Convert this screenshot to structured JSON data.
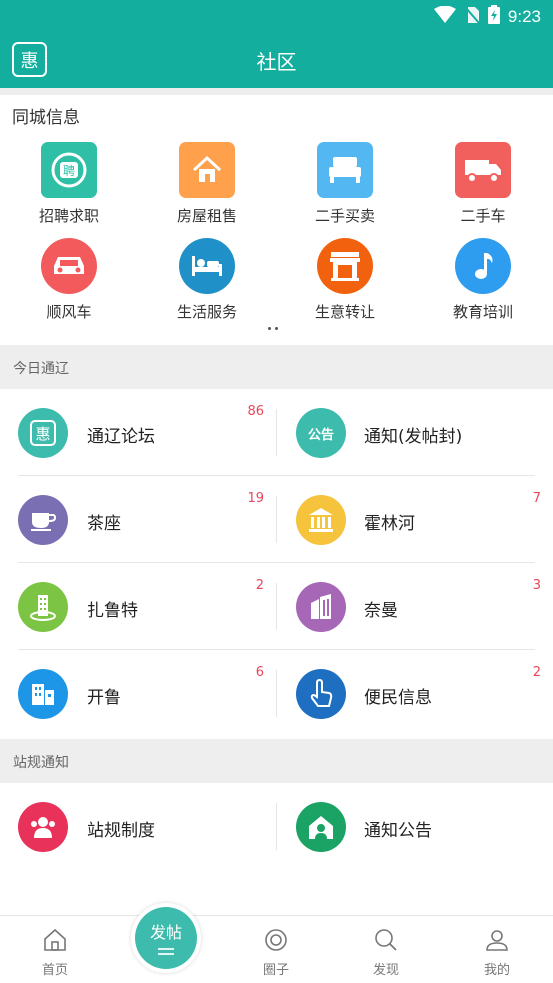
{
  "status_bar": {
    "time": "9:23"
  },
  "app_bar": {
    "title": "社区",
    "logo_glyph": "惠"
  },
  "city_info": {
    "title": "同城信息",
    "items": [
      {
        "label": "招聘求职",
        "icon": "recruit-icon",
        "color": "#2fbfa6"
      },
      {
        "label": "房屋租售",
        "icon": "house-icon",
        "color": "#ffa04d"
      },
      {
        "label": "二手买卖",
        "icon": "bed-icon",
        "color": "#53b7f2"
      },
      {
        "label": "二手车",
        "icon": "truck-icon",
        "color": "#f2605e"
      },
      {
        "label": "顺风车",
        "icon": "car-icon",
        "color": "#f25a5c"
      },
      {
        "label": "生活服务",
        "icon": "bed-service-icon",
        "color": "#2090c8"
      },
      {
        "label": "生意转让",
        "icon": "shop-icon",
        "color": "#f2620e"
      },
      {
        "label": "教育培训",
        "icon": "music-note-icon",
        "color": "#2e9df0"
      }
    ]
  },
  "today_section": {
    "title": "今日通辽",
    "rows": [
      [
        {
          "name": "通辽论坛",
          "count": "86",
          "icon": "hui-icon",
          "color": "#3dbcad"
        },
        {
          "name": "通知(发帖封)",
          "count": "",
          "icon": "notice-icon",
          "color": "#3dbcad",
          "glyph": "公告"
        }
      ],
      [
        {
          "name": "茶座",
          "count": "19",
          "icon": "coffee-cup-icon",
          "color": "#7b6fb3"
        },
        {
          "name": "霍林河",
          "count": "7",
          "icon": "building-columns-icon",
          "color": "#f6c33c"
        }
      ],
      [
        {
          "name": "扎鲁特",
          "count": "2",
          "icon": "tower-icon",
          "color": "#7cc444"
        },
        {
          "name": "奈曼",
          "count": "3",
          "icon": "city-icon",
          "color": "#a667b7"
        }
      ],
      [
        {
          "name": "开鲁",
          "count": "6",
          "icon": "office-icon",
          "color": "#1e96e8"
        },
        {
          "name": "便民信息",
          "count": "2",
          "icon": "hand-pointer-icon",
          "color": "#1e6fc1"
        }
      ]
    ]
  },
  "rules_section": {
    "title": "站规通知",
    "rows": [
      [
        {
          "name": "站规制度",
          "count": "",
          "icon": "people-icon",
          "color": "#e8325a"
        },
        {
          "name": "通知公告",
          "count": "",
          "icon": "home-person-icon",
          "color": "#1aa364"
        }
      ]
    ]
  },
  "bottom_nav": {
    "home": "首页",
    "post": "发帖",
    "circle": "圈子",
    "discover": "发现",
    "mine": "我的"
  }
}
